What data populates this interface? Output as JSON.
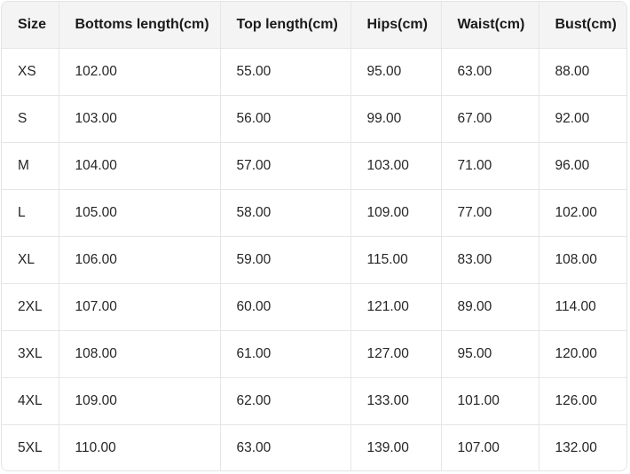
{
  "table": {
    "headers": [
      "Size",
      "Bottoms length(cm)",
      "Top length(cm)",
      "Hips(cm)",
      "Waist(cm)",
      "Bust(cm)"
    ],
    "rows": [
      [
        "XS",
        "102.00",
        "55.00",
        "95.00",
        "63.00",
        "88.00"
      ],
      [
        "S",
        "103.00",
        "56.00",
        "99.00",
        "67.00",
        "92.00"
      ],
      [
        "M",
        "104.00",
        "57.00",
        "103.00",
        "71.00",
        "96.00"
      ],
      [
        "L",
        "105.00",
        "58.00",
        "109.00",
        "77.00",
        "102.00"
      ],
      [
        "XL",
        "106.00",
        "59.00",
        "115.00",
        "83.00",
        "108.00"
      ],
      [
        "2XL",
        "107.00",
        "60.00",
        "121.00",
        "89.00",
        "114.00"
      ],
      [
        "3XL",
        "108.00",
        "61.00",
        "127.00",
        "95.00",
        "120.00"
      ],
      [
        "4XL",
        "109.00",
        "62.00",
        "133.00",
        "101.00",
        "126.00"
      ],
      [
        "5XL",
        "110.00",
        "63.00",
        "139.00",
        "107.00",
        "132.00"
      ]
    ]
  },
  "colors": {
    "header_background": "#f4f4f4",
    "grid_line": "#e6e6e6",
    "text": "#262626"
  }
}
